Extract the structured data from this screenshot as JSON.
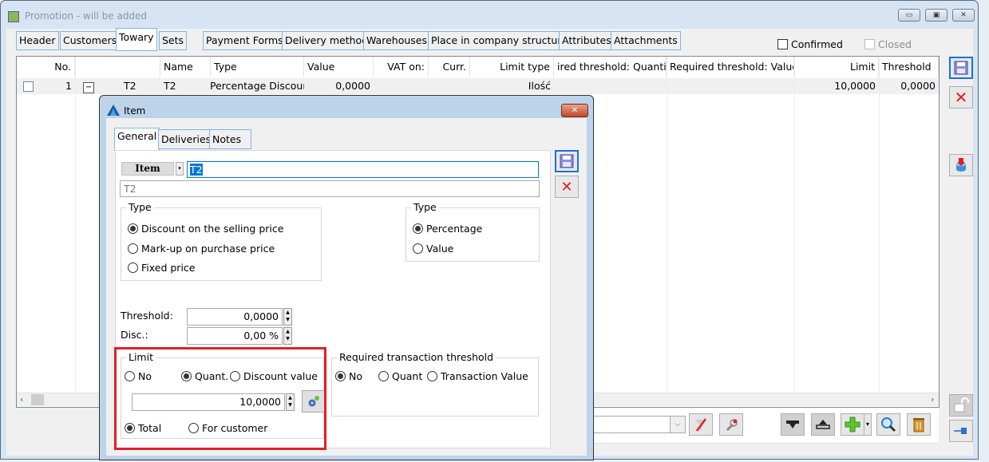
{
  "main_window": {
    "title": "Promotion - will be added",
    "tabs": [
      {
        "label": "Header"
      },
      {
        "label": "Customers"
      },
      {
        "label": "Towary",
        "active": true
      },
      {
        "label": "Sets"
      },
      {
        "label": "Payment Forms"
      },
      {
        "label": "Delivery method"
      },
      {
        "label": "Warehouses"
      },
      {
        "label": "Place in company structure"
      },
      {
        "label": "Attributes"
      },
      {
        "label": "Attachments"
      }
    ],
    "confirmed_label": "Confirmed",
    "closed_label": "Closed",
    "grid": {
      "headers": [
        "No.",
        "",
        "Name",
        "Type",
        "Value",
        "VAT on:",
        "Curr.",
        "Limit type",
        "ired threshold: Quantity",
        "Required threshold: Value",
        "Limit",
        "Threshold"
      ],
      "rows": [
        {
          "no": "1",
          "code": "T2",
          "name": "T2",
          "type": "Percentage Discount",
          "value": "0,0000",
          "vat_on": "",
          "curr": "",
          "limit_type": "Ilość",
          "req_qty": "",
          "req_value": "",
          "limit": "10,0000",
          "threshold": "0,0000"
        }
      ]
    }
  },
  "dialog": {
    "title": "Item",
    "tabs": [
      {
        "label": "General",
        "active": true
      },
      {
        "label": "Deliveries"
      },
      {
        "label": "Notes"
      }
    ],
    "item_button_label": "Item",
    "item_code": "T2",
    "item_name": "T2",
    "type_group": {
      "legend": "Type",
      "options": [
        {
          "label": "Discount on the selling price",
          "selected": true
        },
        {
          "label": "Mark-up on purchase price",
          "selected": false
        },
        {
          "label": "Fixed price",
          "selected": false
        }
      ]
    },
    "value_type_group": {
      "legend": "Type",
      "options": [
        {
          "label": "Percentage",
          "selected": true
        },
        {
          "label": "Value",
          "selected": false
        }
      ]
    },
    "threshold_label": "Threshold:",
    "threshold_value": "0,0000",
    "disc_label": "Disc.:",
    "disc_value": "0,00 %",
    "limit_group": {
      "legend": "Limit",
      "options": [
        {
          "label": "No",
          "selected": false
        },
        {
          "label": "Quant.",
          "selected": true
        },
        {
          "label": "Discount value",
          "selected": false
        }
      ],
      "value": "10,0000",
      "scope_options": [
        {
          "label": "Total",
          "selected": true
        },
        {
          "label": "For customer",
          "selected": false
        }
      ]
    },
    "required_group": {
      "legend": "Required transaction threshold",
      "options": [
        {
          "label": "No",
          "selected": true
        },
        {
          "label": "Quant",
          "selected": false
        },
        {
          "label": "Transaction Value",
          "selected": false
        }
      ]
    }
  },
  "colors": {
    "highlight_border": "#e0202a",
    "selection_blue": "#0078d7",
    "tab_border": "#7eb4ea"
  }
}
